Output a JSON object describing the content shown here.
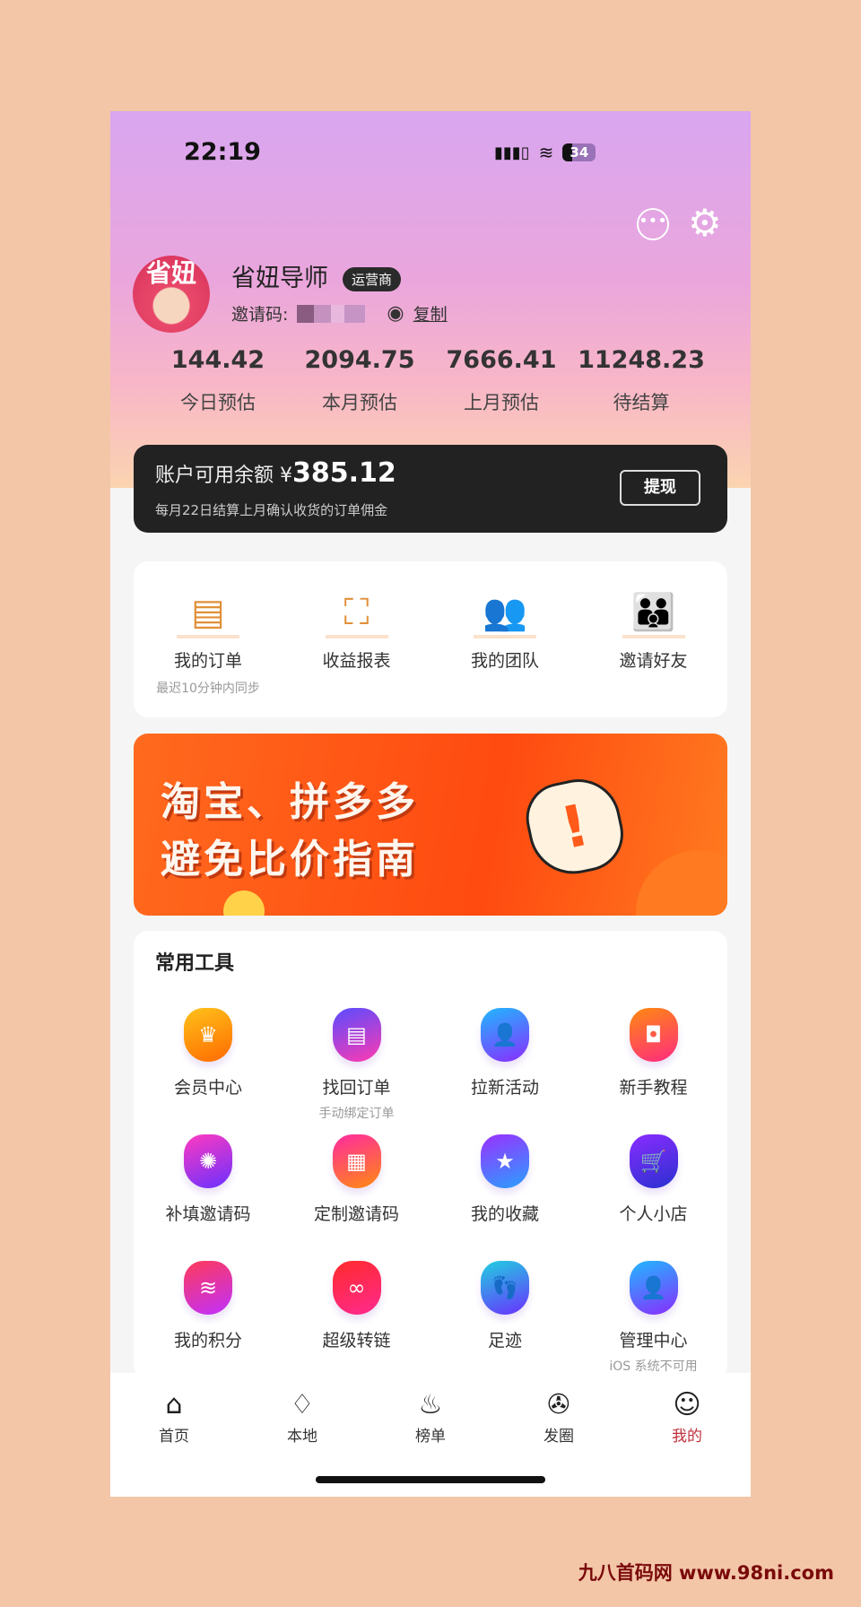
{
  "status": {
    "time": "22:19",
    "battery": "34"
  },
  "profile": {
    "avatar_text": "省妞",
    "name": "省妞导师",
    "role_badge": "运营商",
    "invite_label": "邀请码:",
    "copy_label": "复制"
  },
  "stats": [
    {
      "value": "144.42",
      "label": "今日预估"
    },
    {
      "value": "2094.75",
      "label": "本月预估"
    },
    {
      "value": "7666.41",
      "label": "上月预估"
    },
    {
      "value": "11248.23",
      "label": "待结算"
    }
  ],
  "balance": {
    "label": "账户可用余额",
    "currency": "¥",
    "amount": "385.12",
    "note": "每月22日结算上月确认收货的订单佣金",
    "withdraw_label": "提现"
  },
  "menu": [
    {
      "label": "我的订单",
      "sub": "最迟10分钟内同步",
      "icon": "clipboard-icon"
    },
    {
      "label": "收益报表",
      "icon": "chart-board-icon"
    },
    {
      "label": "我的团队",
      "icon": "team-icon"
    },
    {
      "label": "邀请好友",
      "icon": "invite-friends-icon"
    }
  ],
  "banner": {
    "line1": "淘宝、拼多多",
    "line2": "避免比价指南"
  },
  "tools": {
    "title": "常用工具",
    "items": [
      {
        "label": "会员中心",
        "icon": "crown-icon",
        "glyph": "♛",
        "c1": "#ffc21a",
        "c2": "#ff6a00"
      },
      {
        "label": "找回订单",
        "sub": "手动绑定订单",
        "icon": "clipboard-icon",
        "glyph": "▤",
        "c1": "#5a4cff",
        "c2": "#ff3ab0"
      },
      {
        "label": "拉新活动",
        "icon": "user-card-icon",
        "glyph": "👤",
        "c1": "#20b8ff",
        "c2": "#8a2cff"
      },
      {
        "label": "新手教程",
        "icon": "book-icon",
        "glyph": "◘",
        "c1": "#ff8a10",
        "c2": "#ff2a80"
      },
      {
        "label": "补填邀请码",
        "icon": "aperture-icon",
        "glyph": "✺",
        "c1": "#ff3ac0",
        "c2": "#6a30ff"
      },
      {
        "label": "定制邀请码",
        "icon": "grid-icon",
        "glyph": "▦",
        "c1": "#ff2aa0",
        "c2": "#ff8a10"
      },
      {
        "label": "我的收藏",
        "icon": "star-icon",
        "glyph": "★",
        "c1": "#9a30ff",
        "c2": "#2aa0ff"
      },
      {
        "label": "个人小店",
        "icon": "cart-icon",
        "glyph": "🛒",
        "c1": "#8a2cff",
        "c2": "#2a30d0"
      },
      {
        "label": "我的积分",
        "icon": "coins-icon",
        "glyph": "≋",
        "c1": "#ff3a5a",
        "c2": "#c030ff"
      },
      {
        "label": "超级转链",
        "icon": "link-icon",
        "glyph": "∞",
        "c1": "#ff2a2a",
        "c2": "#ff2a90"
      },
      {
        "label": "足迹",
        "icon": "footprint-icon",
        "glyph": "👣",
        "c1": "#20d0e0",
        "c2": "#6a30ff"
      },
      {
        "label": "管理中心",
        "sub": "iOS 系统不可用",
        "icon": "user-card-icon",
        "glyph": "👤",
        "c1": "#20b8ff",
        "c2": "#8a2cff"
      }
    ]
  },
  "tabbar": [
    {
      "label": "首页",
      "icon": "home-icon",
      "glyph": "⌂"
    },
    {
      "label": "本地",
      "icon": "diamond-icon",
      "glyph": "♢"
    },
    {
      "label": "榜单",
      "icon": "flame-icon",
      "glyph": "♨"
    },
    {
      "label": "发圈",
      "icon": "aperture-icon",
      "glyph": "✇"
    },
    {
      "label": "我的",
      "icon": "profile-icon",
      "glyph": "☺",
      "active": true
    }
  ],
  "colors": {
    "accent": "#c0303a",
    "icon_orange": "#e0903a",
    "banner": "#ff4a10"
  },
  "watermark": "九八首码网 www.98ni.com"
}
